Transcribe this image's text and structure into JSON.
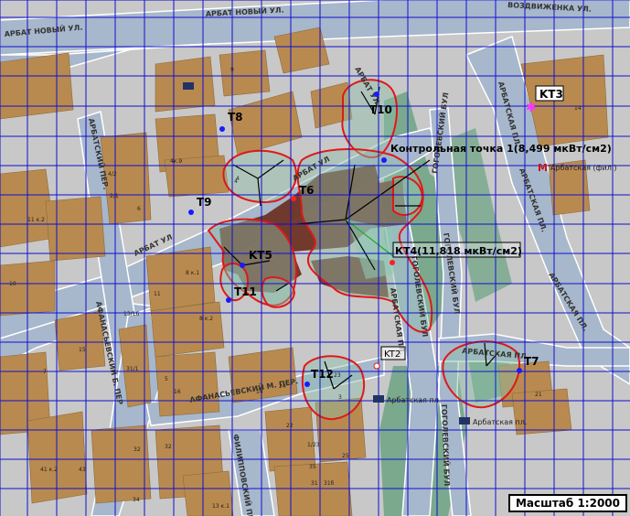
{
  "streets": {
    "arbat_novy": "АРБАТ НОВЫЙ УЛ.",
    "arbat_novy_left": "АРБАТ НОВЫЙ УЛ.",
    "vozdvizhenka": "ВОЗДВИЖЕНКА УЛ.",
    "arbatsky_per": "АРБАТСКИЙ ПЕР.",
    "arbat_ul": "АРБАТ УЛ",
    "arbat_ul_2": "АРБАТ УЛ",
    "afanasievsky_b": "АФАНАСЬЕВСКИЙ Б. ПЕР",
    "afanasievsky_m": "АФАНАСЬЕВСКИЙ М. ПЕР.",
    "filippovsky": "ФИЛИППОВСКИЙ ПЕР",
    "gogolevsky_1": "ГОГОЛЕВСКИЙ БУЛ",
    "gogolevsky_2": "ГОГОЛЕВСКИЙ БУЛ",
    "gogolevsky_3": "ГОГОЛЕВСКИЙ БУЛ",
    "gogolevsky_4": "ГОГОЛЕВСКИЙ БУЛ",
    "arbatskaya_pl_1": "АРБАТСКАЯ ПЛ.",
    "arbatskaya_pl_2": "АРБАТСКАЯ ПЛ.",
    "arbatskaya_pl_3": "АРБАТСКАЯ ПЛ.",
    "arbatskaya_pl_4": "АРБАТСКАЯ ПЛ.",
    "arbatskaya_pl_5": "АРБАТСКАЯ ПЛ.",
    "arbat_ul_3": "АРБАТ УЛ"
  },
  "points": {
    "t6": "T6",
    "t7": "T7",
    "t8": "T8",
    "t9": "T9",
    "t10": "T10",
    "t11": "T11",
    "t12": "T12",
    "kt3": "KT3",
    "kt5": "KT5"
  },
  "boxed_labels": {
    "kt2": "KT2",
    "kt4": "КТ4(11,818 мкВт/см2)"
  },
  "control_point": "Контрольная точка 1(8,499 мкВт/см2)",
  "metro": {
    "arbatskaya_fil": "Арбатская (фил.)",
    "arbatskaya_pl_a": "Арбатская пл.",
    "arbatskaya_pl_b": "Арбатская пл."
  },
  "building_numbers": [
    "9",
    "14",
    "4/2",
    "4к.9",
    "4",
    "2/1",
    "6",
    "11 к.2",
    "10",
    "8 к.1",
    "13/16",
    "11",
    "8 к.2",
    "15",
    "7",
    "31/1",
    "5",
    "16",
    "24",
    "14",
    "3",
    "25",
    "23",
    "22",
    "1/23",
    "21",
    "41 к.2",
    "43",
    "32",
    "32",
    "35",
    "34",
    "31",
    "31б",
    "4",
    "13 к.1"
  ],
  "scale": "Масштаб 1:2000",
  "colors": {
    "street": "#a7b7cc",
    "building": "#b98a4f",
    "park": "#7aa98e",
    "grid": "#1010d0",
    "danger_fill": "#6a2e20",
    "zone_outline": "#e01818",
    "zone_fill": "#7fb59a",
    "point": "#1a1aff",
    "kt3": "#ff33ff"
  }
}
